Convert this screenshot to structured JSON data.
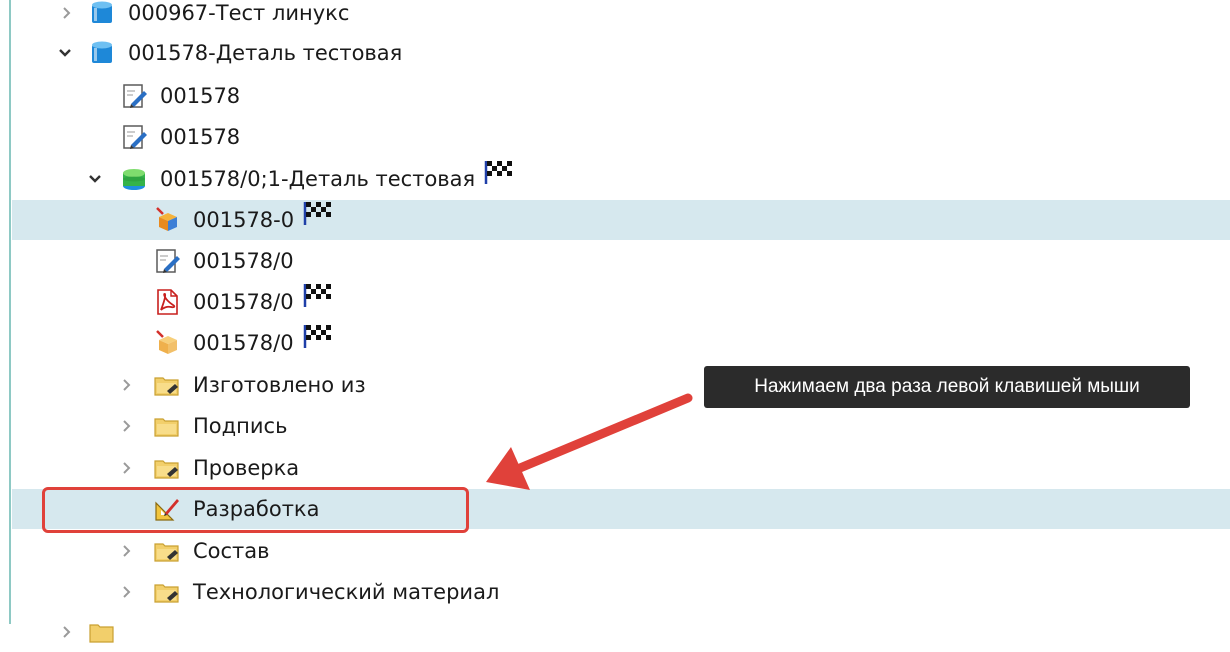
{
  "tree": {
    "items": [
      {
        "label": "000967-Тест линукс"
      },
      {
        "label": "001578-Деталь тестовая"
      },
      {
        "label": "001578"
      },
      {
        "label": "001578"
      },
      {
        "label": "001578/0;1-Деталь тестовая"
      },
      {
        "label": "001578-0"
      },
      {
        "label": "001578/0"
      },
      {
        "label": "001578/0"
      },
      {
        "label": "001578/0"
      },
      {
        "label": "Изготовлено из"
      },
      {
        "label": "Подпись"
      },
      {
        "label": "Проверка"
      },
      {
        "label": "Разработка"
      },
      {
        "label": "Состав"
      },
      {
        "label": "Технологический материал"
      }
    ]
  },
  "callout": {
    "text": "Нажимаем два раза левой клавишей мыши"
  },
  "colors": {
    "selection": "#d6e8ee",
    "accent_red": "#e0413a",
    "callout_bg": "#2b2b2b",
    "edge_line": "#8ec9c4"
  },
  "icons": {
    "product": "db-blue-icon",
    "version": "db-green-icon",
    "document": "document-pencil-icon",
    "pdf": "pdf-icon",
    "model": "box-3d-icon",
    "folder": "folder-icon",
    "design": "drafting-icon",
    "status": "checkered-flag-icon"
  }
}
